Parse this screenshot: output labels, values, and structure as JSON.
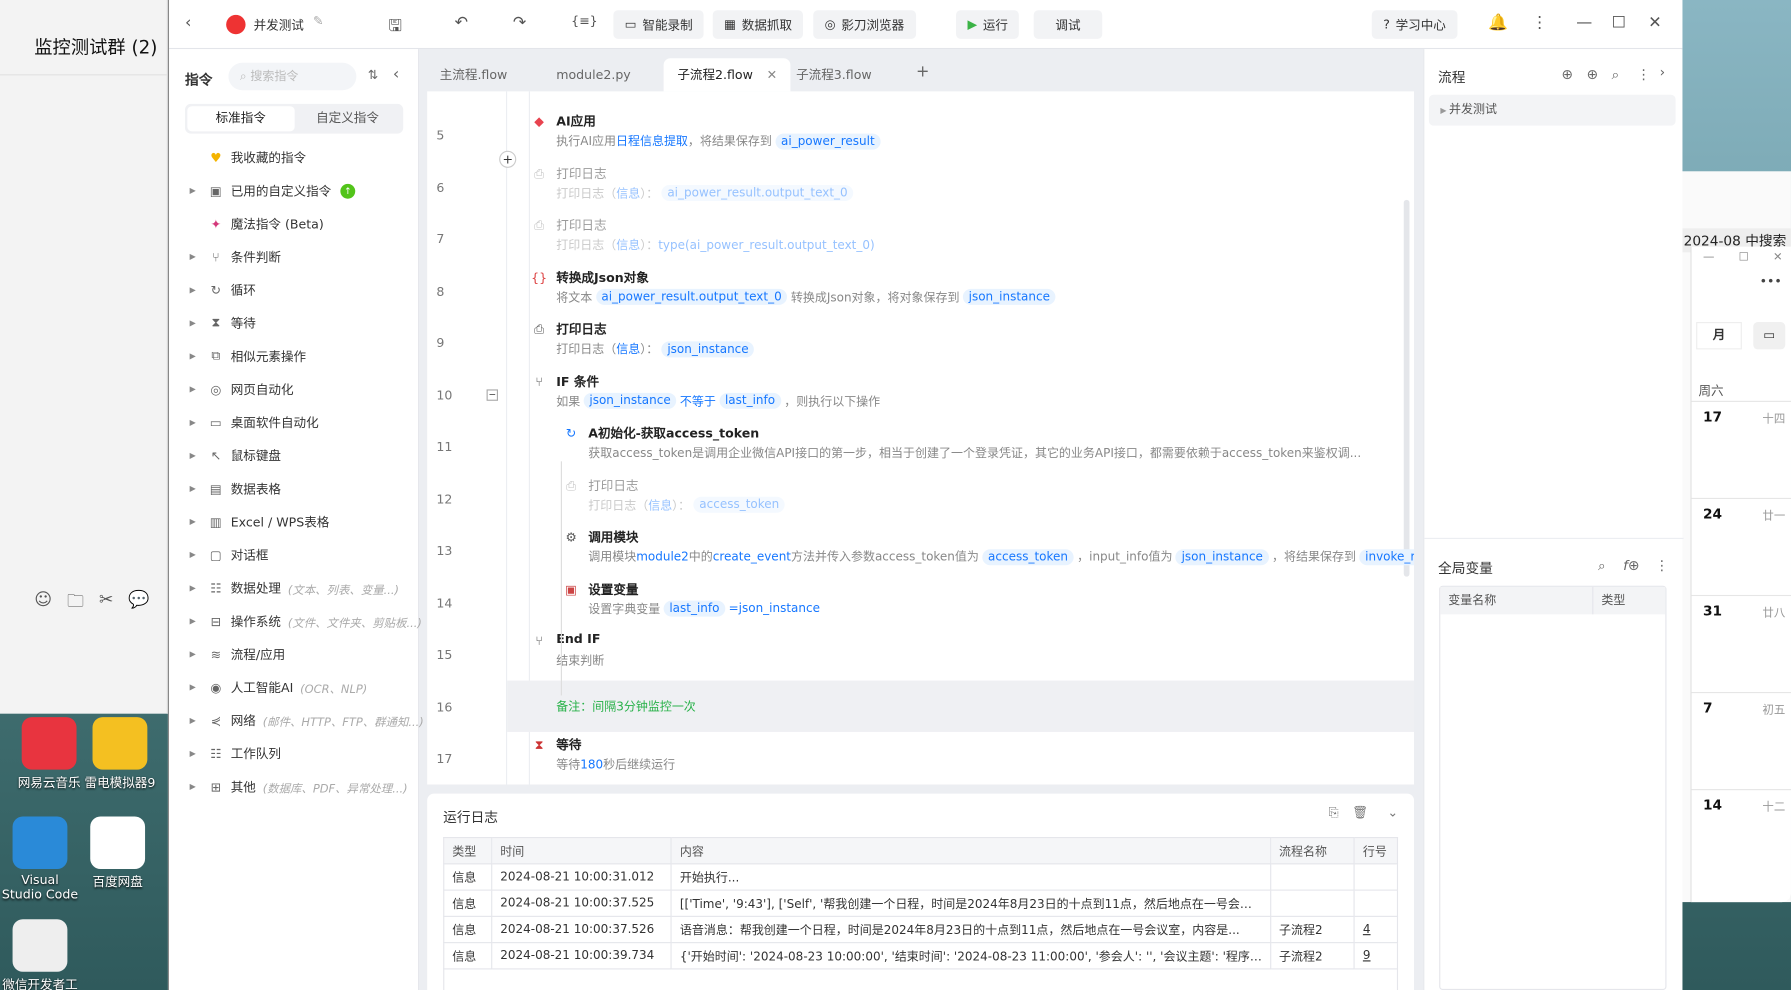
{
  "wechat": {
    "title": "监控测试群 (2)"
  },
  "desktop": {
    "icons": [
      {
        "label": "网易云音乐",
        "color": "#e8343f"
      },
      {
        "label": "雷电模拟器9",
        "color": "#f4c021"
      },
      {
        "label": "Visual Studio Code",
        "color": "#2a8ad8"
      },
      {
        "label": "百度网盘",
        "color": "#ffffff"
      },
      {
        "label": "微信开发者工具",
        "color": "#eeeeee"
      }
    ]
  },
  "calendar": {
    "search": "2024-08 中搜索",
    "view": "月",
    "weekday": "周六",
    "days": [
      {
        "d": "17",
        "l": "十四"
      },
      {
        "d": "24",
        "l": "廿一"
      },
      {
        "d": "31",
        "l": "廿八"
      },
      {
        "d": "7",
        "l": "初五"
      },
      {
        "d": "14",
        "l": "十二"
      }
    ]
  },
  "titlebar": {
    "project": "并发测试",
    "smart_record": "智能录制",
    "data_grab": "数据抓取",
    "browser": "影刀浏览器",
    "run": "运行",
    "debug": "调试",
    "learn": "学习中心"
  },
  "left": {
    "title": "指令",
    "search_placeholder": "搜索指令",
    "tab_standard": "标准指令",
    "tab_custom": "自定义指令",
    "items": [
      {
        "label": "我收藏的指令",
        "icon": "♥",
        "arrow": false,
        "hint": ""
      },
      {
        "label": "已用的自定义指令",
        "icon": "▣",
        "arrow": true,
        "hint": ""
      },
      {
        "label": "魔法指令 (Beta)",
        "icon": "✦",
        "arrow": false,
        "hint": ""
      },
      {
        "label": "条件判断",
        "icon": "⑂",
        "arrow": true,
        "hint": ""
      },
      {
        "label": "循环",
        "icon": "↻",
        "arrow": true,
        "hint": ""
      },
      {
        "label": "等待",
        "icon": "⧗",
        "arrow": true,
        "hint": ""
      },
      {
        "label": "相似元素操作",
        "icon": "⧉",
        "arrow": true,
        "hint": ""
      },
      {
        "label": "网页自动化",
        "icon": "◎",
        "arrow": true,
        "hint": ""
      },
      {
        "label": "桌面软件自动化",
        "icon": "▭",
        "arrow": true,
        "hint": ""
      },
      {
        "label": "鼠标键盘",
        "icon": "↖",
        "arrow": true,
        "hint": ""
      },
      {
        "label": "数据表格",
        "icon": "▤",
        "arrow": true,
        "hint": ""
      },
      {
        "label": "Excel / WPS表格",
        "icon": "▥",
        "arrow": true,
        "hint": ""
      },
      {
        "label": "对话框",
        "icon": "▢",
        "arrow": true,
        "hint": ""
      },
      {
        "label": "数据处理",
        "icon": "☷",
        "arrow": true,
        "hint": "(文本、列表、变量...)"
      },
      {
        "label": "操作系统",
        "icon": "⊟",
        "arrow": true,
        "hint": "(文件、文件夹、剪贴板...)"
      },
      {
        "label": "流程/应用",
        "icon": "≋",
        "arrow": true,
        "hint": ""
      },
      {
        "label": "人工智能AI",
        "icon": "◉",
        "arrow": true,
        "hint": "(OCR、NLP)"
      },
      {
        "label": "网络",
        "icon": "⋞",
        "arrow": true,
        "hint": "(邮件、HTTP、FTP、群通知...)"
      },
      {
        "label": "工作队列",
        "icon": "☷",
        "arrow": true,
        "hint": ""
      },
      {
        "label": "其他",
        "icon": "⊞",
        "arrow": true,
        "hint": "(数据库、PDF、异常处理...)"
      }
    ]
  },
  "tabs": [
    {
      "label": "主流程.flow"
    },
    {
      "label": "module2.py"
    },
    {
      "label": "子流程2.flow",
      "active": true
    },
    {
      "label": "子流程3.flow"
    }
  ],
  "flow": {
    "steps": [
      {
        "line": "5",
        "indent": 0,
        "icon": "◆",
        "iconColor": "#e8434f",
        "title": "AI应用",
        "desc": [
          [
            "t",
            "执行AI应用"
          ],
          [
            "l",
            "日程信息提取"
          ],
          [
            "t",
            "，将结果保存到"
          ],
          [
            "v",
            "ai_power_result"
          ]
        ]
      },
      {
        "line": "6",
        "indent": 0,
        "dim": true,
        "icon": "⎙",
        "iconColor": "#777",
        "title": "打印日志",
        "desc": [
          [
            "t",
            "打印日志（"
          ],
          [
            "l",
            "信息"
          ],
          [
            "t",
            "）："
          ],
          [
            "v",
            "ai_power_result.output_text_0"
          ]
        ]
      },
      {
        "line": "7",
        "indent": 0,
        "dim": true,
        "icon": "⎙",
        "iconColor": "#777",
        "title": "打印日志",
        "desc": [
          [
            "t",
            "打印日志（"
          ],
          [
            "l",
            "信息"
          ],
          [
            "t",
            "）："
          ],
          [
            "l",
            "type(ai_power_result.output_text_0)"
          ]
        ]
      },
      {
        "line": "8",
        "indent": 0,
        "icon": "{}",
        "iconColor": "#d44",
        "title": "转换成Json对象",
        "desc": [
          [
            "t",
            "将文本"
          ],
          [
            "v",
            "ai_power_result.output_text_0"
          ],
          [
            "t",
            "转换成Json对象，将对象保存到"
          ],
          [
            "v",
            "json_instance"
          ]
        ]
      },
      {
        "line": "9",
        "indent": 0,
        "icon": "⎙",
        "iconColor": "#555",
        "title": "打印日志",
        "desc": [
          [
            "t",
            "打印日志（"
          ],
          [
            "l",
            "信息"
          ],
          [
            "t",
            "）："
          ],
          [
            "v",
            "json_instance"
          ]
        ]
      },
      {
        "line": "10",
        "indent": 0,
        "icon": "⑂",
        "iconColor": "#555",
        "title": "IF 条件",
        "collapse": true,
        "desc": [
          [
            "t",
            "如果"
          ],
          [
            "v",
            "json_instance"
          ],
          [
            "l",
            "不等于"
          ],
          [
            "v",
            "last_info"
          ],
          [
            "t",
            "，则执行以下操作"
          ]
        ]
      },
      {
        "line": "11",
        "indent": 1,
        "icon": "↻",
        "iconColor": "#1677ff",
        "title": "A初始化-获取access_token",
        "desc": [
          [
            "t",
            "获取access_token是调用企业微信API接口的第一步，相当于创建了一个登录凭证，其它的业务API接口，都需要依赖于access_token来鉴权调..."
          ]
        ]
      },
      {
        "line": "12",
        "indent": 1,
        "dim": true,
        "icon": "⎙",
        "iconColor": "#777",
        "title": "打印日志",
        "desc": [
          [
            "t",
            "打印日志（"
          ],
          [
            "l",
            "信息"
          ],
          [
            "t",
            "）："
          ],
          [
            "v",
            "access_token"
          ]
        ]
      },
      {
        "line": "13",
        "indent": 1,
        "icon": "⚙",
        "iconColor": "#555",
        "title": "调用模块",
        "desc": [
          [
            "t",
            "调用模块"
          ],
          [
            "l",
            "module2"
          ],
          [
            "t",
            "中的"
          ],
          [
            "l",
            "create_event"
          ],
          [
            "t",
            "方法并传入参数access_token值为"
          ],
          [
            "v",
            "access_token"
          ],
          [
            "t",
            "，input_info值为"
          ],
          [
            "v",
            "json_instance"
          ],
          [
            "t",
            "，将结果保存到"
          ],
          [
            "v",
            "invoke_res"
          ]
        ]
      },
      {
        "line": "14",
        "indent": 1,
        "icon": "▣",
        "iconColor": "#c44",
        "title": "设置变量",
        "desc": [
          [
            "t",
            "设置字典变量"
          ],
          [
            "v",
            "last_info"
          ],
          [
            "l",
            "=json_instance"
          ]
        ]
      },
      {
        "line": "15",
        "indent": 0,
        "icon": "⑂",
        "iconColor": "#555",
        "title": "End IF",
        "desc": [
          [
            "t",
            "结束判断"
          ]
        ]
      },
      {
        "line": "16",
        "indent": 0,
        "note": true,
        "title": "",
        "desc": [
          [
            "t",
            "备注：间隔3分钟监控一次"
          ]
        ]
      },
      {
        "line": "17",
        "indent": 0,
        "icon": "⧗",
        "iconColor": "#c33",
        "title": "等待",
        "desc": [
          [
            "t",
            "等待"
          ],
          [
            "l",
            "180"
          ],
          [
            "t",
            "秒后继续运行"
          ]
        ]
      }
    ]
  },
  "log": {
    "title": "运行日志",
    "columns": [
      "类型",
      "时间",
      "内容",
      "流程名称",
      "行号"
    ],
    "rows": [
      [
        "信息",
        "2024-08-21 10:00:31.012",
        "开始执行...",
        "",
        ""
      ],
      [
        "信息",
        "2024-08-21 10:00:37.525",
        "[['Time', '9:43'], ['Self', '帮我创建一个日程，时间是2024年8月23日的十点到11点，然后地点在一号会议...",
        "",
        ""
      ],
      [
        "信息",
        "2024-08-21 10:00:37.526",
        "语音消息：帮我创建一个日程，时间是2024年8月23日的十点到11点，然后地点在一号会议室，内容是...",
        "子流程2",
        "4"
      ],
      [
        "信息",
        "2024-08-21 10:00:39.734",
        "{'开始时间': '2024-08-23 10:00:00', '结束时间': '2024-08-23 11:00:00', '参会人': '', '会议主题': '程序调...",
        "子流程2",
        "9"
      ]
    ]
  },
  "right": {
    "flow_title": "流程",
    "flow_item": "并发测试",
    "globals_title": "全局变量",
    "col_name": "变量名称",
    "col_type": "类型"
  }
}
